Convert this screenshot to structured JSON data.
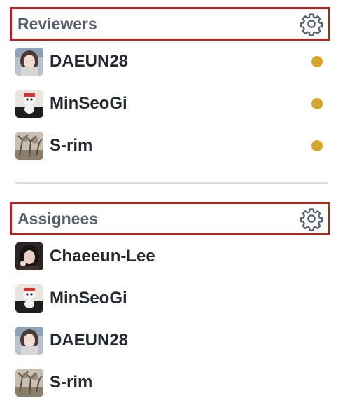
{
  "reviewers": {
    "title": "Reviewers",
    "pending_color": "#d4a72c",
    "items": [
      {
        "username": "DAEUN28",
        "avatar": "avatar-girl-light",
        "status": "pending"
      },
      {
        "username": "MinSeoGi",
        "avatar": "avatar-mascot-black",
        "status": "pending"
      },
      {
        "username": "S-rim",
        "avatar": "avatar-tree",
        "status": "pending"
      }
    ]
  },
  "assignees": {
    "title": "Assignees",
    "items": [
      {
        "username": "Chaeeun-Lee",
        "avatar": "avatar-girl-dark"
      },
      {
        "username": "MinSeoGi",
        "avatar": "avatar-mascot-black"
      },
      {
        "username": "DAEUN28",
        "avatar": "avatar-girl-light"
      },
      {
        "username": "S-rim",
        "avatar": "avatar-tree"
      }
    ]
  },
  "icons": {
    "settings": "gear-icon",
    "status": "dot-icon"
  },
  "colors": {
    "highlight_border": "#b3261e",
    "header_text": "#57606a",
    "username_text": "#24292f",
    "divider": "#d8dee4"
  }
}
